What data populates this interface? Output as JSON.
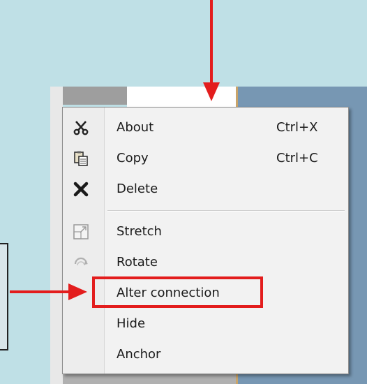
{
  "menu": {
    "items": [
      {
        "label": "About",
        "shortcut": "Ctrl+X",
        "icon": "scissors-icon"
      },
      {
        "label": "Copy",
        "shortcut": "Ctrl+C",
        "icon": "copy-icon"
      },
      {
        "label": "Delete",
        "shortcut": "",
        "icon": "delete-x-icon"
      },
      {
        "label": "Stretch",
        "shortcut": "",
        "icon": "stretch-icon"
      },
      {
        "label": "Rotate",
        "shortcut": "",
        "icon": "rotate-icon"
      },
      {
        "label": "Alter connection",
        "shortcut": "",
        "icon": ""
      },
      {
        "label": "Hide",
        "shortcut": "",
        "icon": ""
      },
      {
        "label": "Anchor",
        "shortcut": "",
        "icon": ""
      }
    ]
  },
  "colors": {
    "annotation_red": "#e31d1d",
    "menu_background": "#f2f2f2",
    "page_background": "#bfe0e6"
  },
  "annotations": {
    "highlighted_item": "Alter connection"
  }
}
